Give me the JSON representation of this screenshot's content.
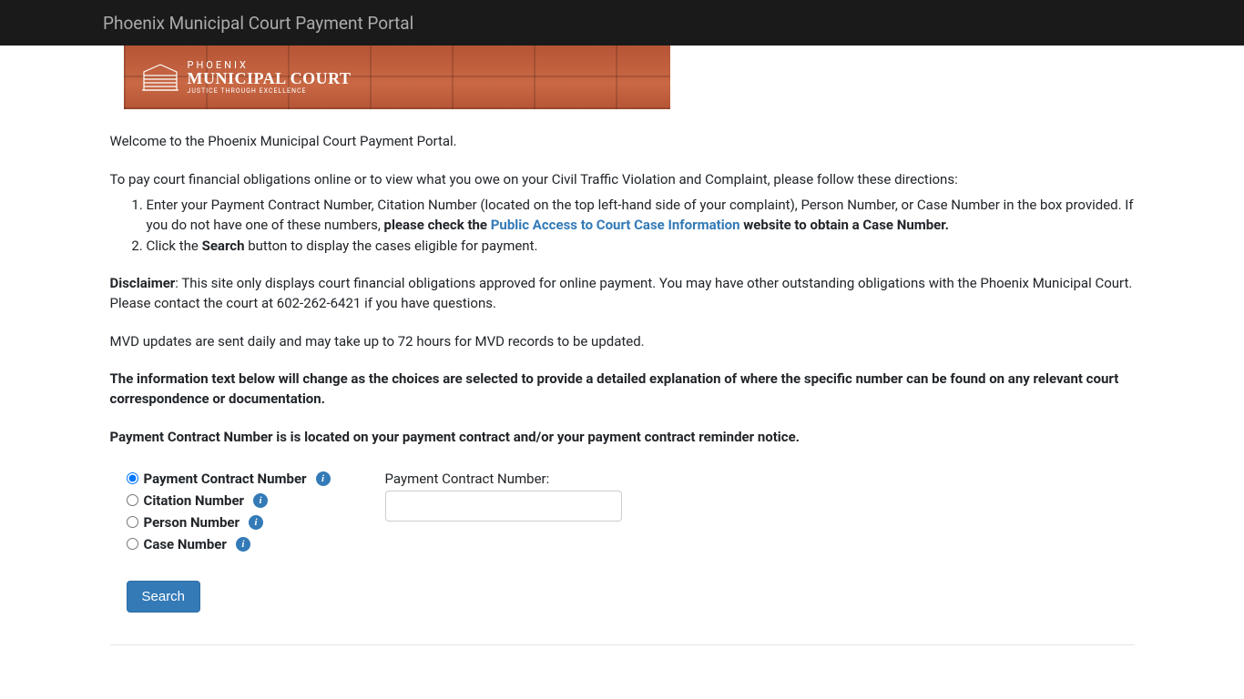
{
  "navbar": {
    "title": "Phoenix Municipal Court Payment Portal"
  },
  "banner": {
    "city": "PHOENIX",
    "court": "MUNICIPAL COURT",
    "tag": "JUSTICE THROUGH EXCELLENCE"
  },
  "intro": {
    "welcome": "Welcome to the Phoenix Municipal Court Payment Portal.",
    "directions": "To pay court financial obligations online or to view what you owe on your Civil Traffic Violation and Complaint, please follow these directions:",
    "step1_a": "Enter your Payment Contract Number, Citation Number (located on the top left-hand side of your complaint), Person Number, or Case Number in the box provided. If you do not have one of these numbers, ",
    "step1_b": "please check the ",
    "step1_link": "Public Access to Court Case Information",
    "step1_c": " website to obtain a Case Number.",
    "step2_a": "Click the ",
    "step2_b": "Search",
    "step2_c": " button to display the cases eligible for payment."
  },
  "disclaimer": {
    "label": "Disclaimer",
    "text": ": This site only displays court financial obligations approved for online payment. You may have other outstanding obligations with the Phoenix Municipal Court. Please contact the court at 602-262-6421 if you have questions."
  },
  "mvd": "MVD updates are sent daily and may take up to 72 hours for MVD records to be updated.",
  "info_dynamic": "The information text below will change as the choices are selected to provide a detailed explanation of where the specific number can be found on any relevant court correspondence or documentation.",
  "selected_help": "Payment Contract Number is is located on your payment contract and/or your payment contract reminder notice.",
  "radios": {
    "opt1": "Payment Contract Number",
    "opt2": "Citation Number",
    "opt3": "Person Number",
    "opt4": "Case Number"
  },
  "input": {
    "label": "Payment Contract Number:"
  },
  "buttons": {
    "search": "Search"
  },
  "info_char": "i"
}
